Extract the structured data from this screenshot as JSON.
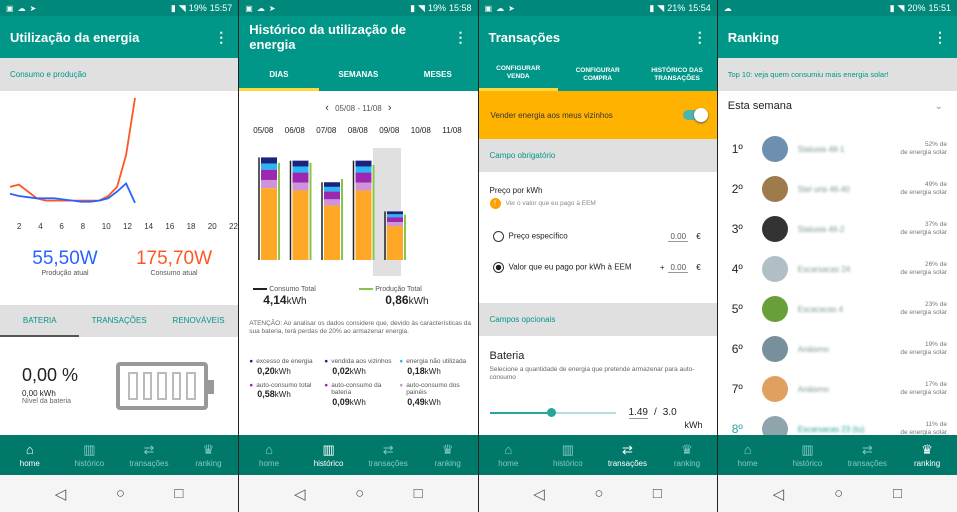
{
  "status": [
    {
      "battery": "19%",
      "time": "15:57"
    },
    {
      "battery": "19%",
      "time": "15:58"
    },
    {
      "battery": "21%",
      "time": "15:54"
    },
    {
      "battery": "20%",
      "time": "15:51"
    }
  ],
  "nav": {
    "home": "home",
    "historico": "histórico",
    "transacoes": "transações",
    "ranking": "ranking"
  },
  "p1": {
    "title": "Utilização da energia",
    "section": "Consumo e produção",
    "ticks": [
      "2",
      "4",
      "6",
      "8",
      "10",
      "12",
      "14",
      "16",
      "18",
      "20",
      "22"
    ],
    "prod_value": "55,50W",
    "prod_label": "Produção atual",
    "cons_value": "175,70W",
    "cons_label": "Consumo atual",
    "tabs": [
      "BATERIA",
      "TRANSAÇÕES",
      "RENOVÁVEIS"
    ],
    "battery_pct": "0,00 %",
    "battery_kwh": "0,00 kWh",
    "battery_label": "Nível da bateria",
    "battery_level": 0,
    "colors": {
      "production": "#2962ff",
      "consumption": "#ff5722"
    },
    "chart_data": {
      "type": "line",
      "x": [
        0,
        1,
        2,
        3,
        4,
        5,
        6,
        7,
        8,
        9,
        10,
        11,
        12,
        13,
        14
      ],
      "series": [
        {
          "values": [
            0.22,
            0.24,
            0.18,
            0.12,
            0.1,
            0.1,
            0.1,
            0.1,
            0.1,
            0.1,
            0.1,
            0.14,
            0.22,
            0.5,
            1.0
          ]
        },
        {
          "values": [
            0.16,
            0.14,
            0.13,
            0.12,
            0.12,
            0.12,
            0.11,
            0.1,
            0.09,
            0.09,
            0.1,
            0.12,
            0.18,
            0.25,
            0.08
          ]
        }
      ]
    }
  },
  "p2": {
    "title": "Histórico da utilização de energia",
    "tabs": [
      "DIAS",
      "SEMANAS",
      "MESES"
    ],
    "range": "05/08 - 11/08",
    "days": [
      "05/08",
      "06/08",
      "07/08",
      "08/08",
      "09/08",
      "10/08",
      "11/08"
    ],
    "consumo_label": "Consumo Total",
    "consumo_value": "4,14",
    "unit": "kWh",
    "producao_label": "Produção Total",
    "producao_value": "0,86",
    "warning": "ATENÇÃO: Ao analisar os dados considere que, devido às características da sua bateria, terá perdas de 20% ao armazenar energia.",
    "legend": [
      {
        "label": "excesso de energia",
        "value": "0,20",
        "color": "#1a237e"
      },
      {
        "label": "vendida aos vizinhos",
        "value": "0,02",
        "color": "#1a237e"
      },
      {
        "label": "energia não utilizada",
        "value": "0,18",
        "color": "#29b6f6"
      },
      {
        "label": "auto-consumo total",
        "value": "0,58",
        "color": "#9c27b0"
      },
      {
        "label": "auto-consumo da bateria",
        "value": "0,09",
        "color": "#9c27b0"
      },
      {
        "label": "auto-consumo dos painéis",
        "value": "0,49",
        "color": "#ce93d8"
      }
    ],
    "chart_data": {
      "type": "bar",
      "categories": [
        "05/08",
        "06/08",
        "07/08",
        "08/08",
        "09/08",
        "10/08",
        "11/08"
      ],
      "series": [
        {
          "name": "Consumo Total",
          "values": [
            0.95,
            0.92,
            0.72,
            0.92,
            0.45,
            0,
            0
          ]
        },
        {
          "name": "Produção Total",
          "values": [
            0.9,
            0.9,
            0.75,
            0.88,
            0.42,
            0,
            0
          ]
        }
      ]
    }
  },
  "p3": {
    "title": "Transações",
    "tabs": [
      "CONFIGURAR VENDA",
      "CONFIGURAR COMPRA",
      "HISTÓRICO DAS TRANSAÇÕES"
    ],
    "sell_label": "Vender energia aos meus vizinhos",
    "required": "Campo obrigatório",
    "price_label": "Preço por kWh",
    "info": "Ver o valor que eu pago à EEM",
    "opt1": "Preço específico",
    "opt1_value": "0.00",
    "cur": "€",
    "opt2": "Valor que eu pago por kWh à EEM",
    "opt2_prefix": "+",
    "opt2_value": "0.00",
    "optional": "Campos opcionais",
    "battery_title": "Bateria",
    "battery_desc": "Selecione a quantidade de energia que pretende armazenar para auto-consumo",
    "slider_value": "1.49",
    "slider_sep": "/",
    "slider_max": "3.0",
    "slider_unit": "kWh",
    "slider_fraction": 0.49
  },
  "p4": {
    "title": "Ranking",
    "banner": "Top 10: veja quem consumiu mais energia solar!",
    "week": "Esta semana",
    "suffix": "de energia solar",
    "rows": [
      {
        "pos": "1º",
        "name": "Stalusia 48-1",
        "pct": "52% de",
        "color": "#6d8fb0"
      },
      {
        "pos": "2º",
        "name": "Stel uria 46-40",
        "pct": "49% de",
        "color": "#9e7b4a"
      },
      {
        "pos": "3º",
        "name": "Stalusia 46-2",
        "pct": "37% de",
        "color": "#333"
      },
      {
        "pos": "4º",
        "name": "Escarsacas 24",
        "pct": "26% de",
        "color": "#b0bec5"
      },
      {
        "pos": "5º",
        "name": "Escacacas 4",
        "pct": "23% de",
        "color": "#689f38"
      },
      {
        "pos": "6º",
        "name": "Anáismo",
        "pct": "19% de",
        "color": "#78909c"
      },
      {
        "pos": "7º",
        "name": "Anáismo",
        "pct": "17% de",
        "color": "#e0a060"
      },
      {
        "pos": "8º",
        "name": "Escarsacas 23 (tu)",
        "pct": "11% de",
        "color": "#90a4ae"
      }
    ]
  }
}
